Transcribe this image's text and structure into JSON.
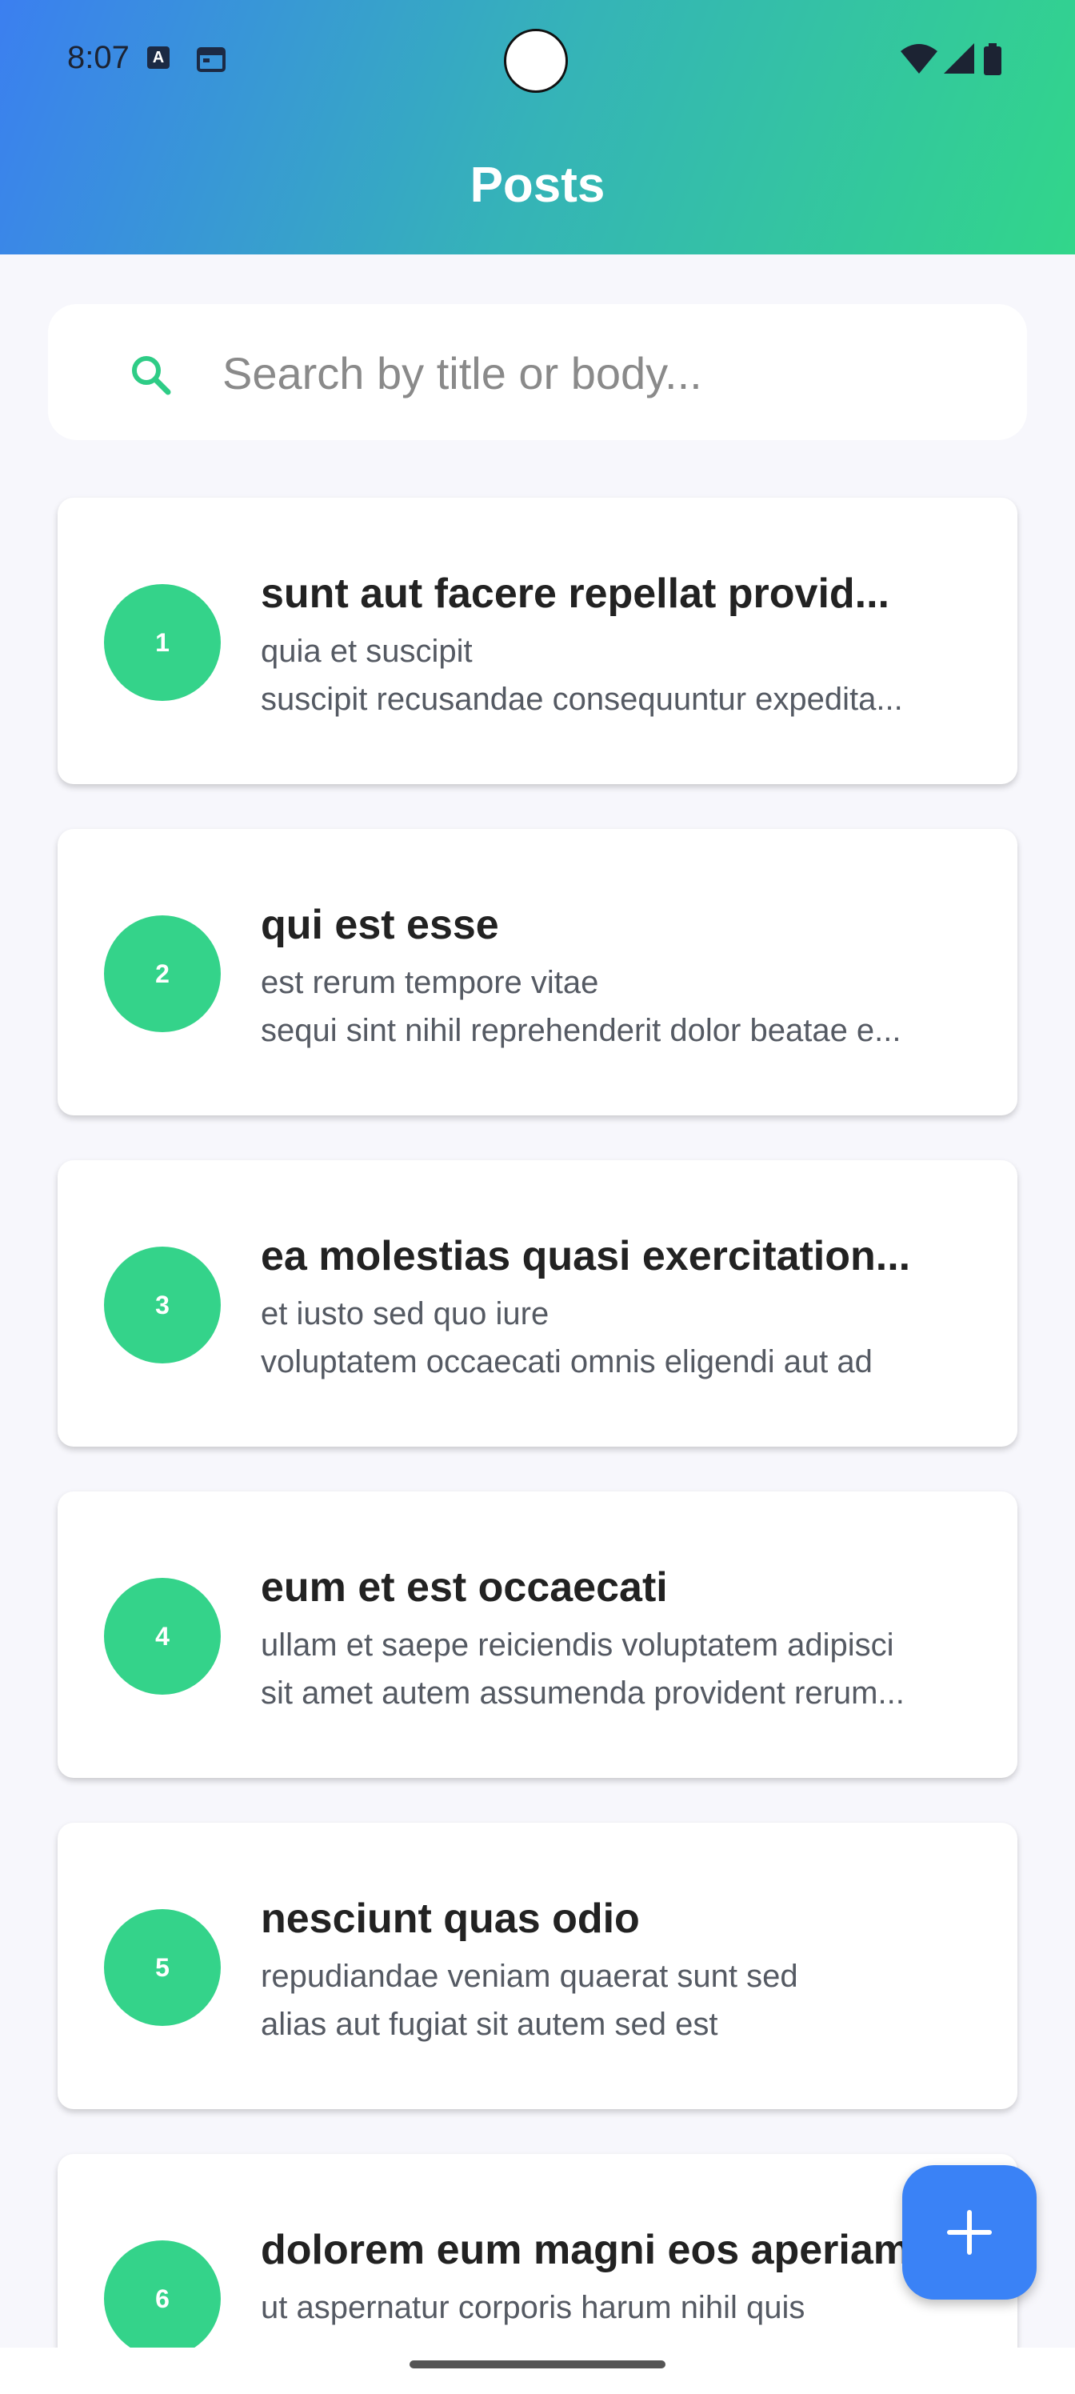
{
  "status_bar": {
    "time": "8:07",
    "icons": [
      "autofill-icon",
      "calendar-icon",
      "wifi-icon",
      "signal-icon",
      "battery-icon"
    ]
  },
  "header": {
    "title": "Posts",
    "gradient": [
      "#3b7ff0",
      "#32d68a"
    ]
  },
  "search": {
    "placeholder": "Search by title or body...",
    "value": "",
    "icon": "search-icon",
    "icon_color": "#2ecc86"
  },
  "posts": [
    {
      "id": "1",
      "title": "sunt aut facere repellat provid...",
      "body_line1": "quia et suscipit",
      "body_line2": "suscipit recusandae consequuntur expedita..."
    },
    {
      "id": "2",
      "title": "qui est esse",
      "body_line1": "est rerum tempore vitae",
      "body_line2": "sequi sint nihil reprehenderit dolor beatae e..."
    },
    {
      "id": "3",
      "title": "ea molestias quasi exercitation...",
      "body_line1": "et iusto sed quo iure",
      "body_line2": "voluptatem occaecati omnis eligendi aut ad"
    },
    {
      "id": "4",
      "title": "eum et est occaecati",
      "body_line1": "ullam et saepe reiciendis voluptatem adipisci",
      "body_line2": "sit amet autem assumenda provident rerum..."
    },
    {
      "id": "5",
      "title": "nesciunt quas odio",
      "body_line1": "repudiandae veniam quaerat sunt sed",
      "body_line2": "alias aut fugiat sit autem sed est"
    },
    {
      "id": "6",
      "title": "dolorem eum magni eos aperiam",
      "body_line1": "ut aspernatur corporis harum nihil quis",
      "body_line2": ""
    }
  ],
  "fab": {
    "icon": "plus-icon",
    "color": "#3a82f6"
  },
  "colors": {
    "background": "#f7f7fc",
    "avatar": "#34d38a",
    "title_text": "#222222",
    "body_text": "#555a63"
  }
}
